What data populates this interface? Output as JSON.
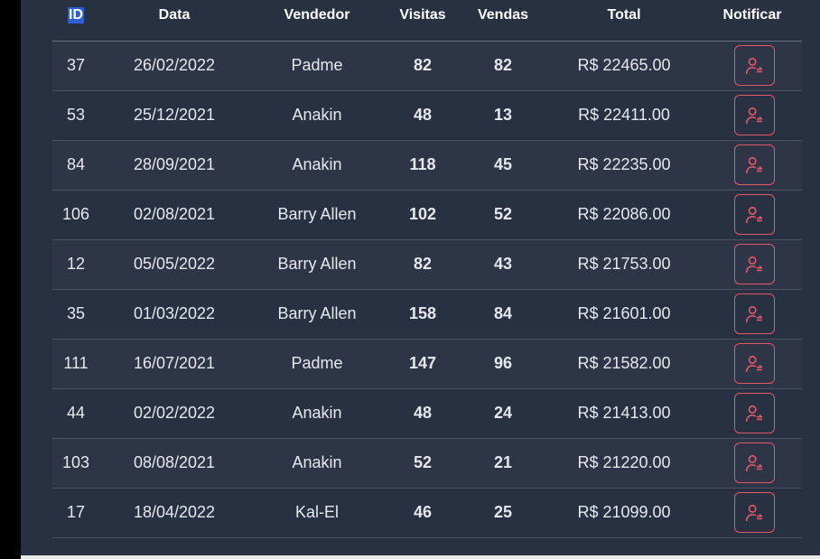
{
  "table": {
    "headers": [
      "ID",
      "Data",
      "Vendedor",
      "Visitas",
      "Vendas",
      "Total",
      "Notificar"
    ],
    "rows": [
      {
        "id": "37",
        "data": "26/02/2022",
        "vendedor": "Padme",
        "visitas": "82",
        "vendas": "82",
        "total": "R$ 22465.00"
      },
      {
        "id": "53",
        "data": "25/12/2021",
        "vendedor": "Anakin",
        "visitas": "48",
        "vendas": "13",
        "total": "R$ 22411.00"
      },
      {
        "id": "84",
        "data": "28/09/2021",
        "vendedor": "Anakin",
        "visitas": "118",
        "vendas": "45",
        "total": "R$ 22235.00"
      },
      {
        "id": "106",
        "data": "02/08/2021",
        "vendedor": "Barry Allen",
        "visitas": "102",
        "vendas": "52",
        "total": "R$ 22086.00"
      },
      {
        "id": "12",
        "data": "05/05/2022",
        "vendedor": "Barry Allen",
        "visitas": "82",
        "vendas": "43",
        "total": "R$ 21753.00"
      },
      {
        "id": "35",
        "data": "01/03/2022",
        "vendedor": "Barry Allen",
        "visitas": "158",
        "vendas": "84",
        "total": "R$ 21601.00"
      },
      {
        "id": "111",
        "data": "16/07/2021",
        "vendedor": "Padme",
        "visitas": "147",
        "vendas": "96",
        "total": "R$ 21582.00"
      },
      {
        "id": "44",
        "data": "02/02/2022",
        "vendedor": "Anakin",
        "visitas": "48",
        "vendas": "24",
        "total": "R$ 21413.00"
      },
      {
        "id": "103",
        "data": "08/08/2021",
        "vendedor": "Anakin",
        "visitas": "52",
        "vendas": "21",
        "total": "R$ 21220.00"
      },
      {
        "id": "17",
        "data": "18/04/2022",
        "vendedor": "Kal-El",
        "visitas": "46",
        "vendas": "25",
        "total": "R$ 21099.00"
      }
    ],
    "notify_icon": "user-notify-icon"
  },
  "colors": {
    "background": "#283142",
    "row_alt": "#2d3546",
    "accent_red": "#e15867",
    "text": "#ffffff"
  }
}
